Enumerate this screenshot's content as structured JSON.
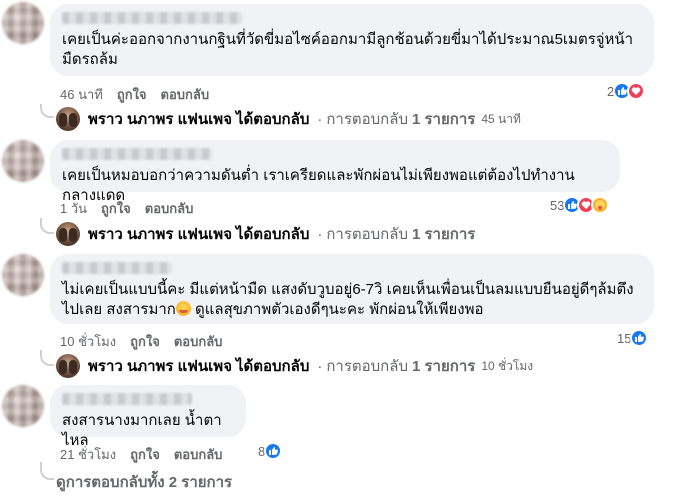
{
  "comments": [
    {
      "text": "เคยเป็นค่ะออกจากงานกฐินที่วัดขี่มอไซค์ออกมามีลูกช้อนด้วยขี่มาได้ประมาณ5เมตรจู่หน้ามืดรถล้ม",
      "time": "46 นาที",
      "like": "ถูกใจ",
      "reply": "ตอบกลับ",
      "reactions": "2",
      "reply_preview": {
        "name": "พราว นภาพร แฟนเพจ",
        "action": "ได้ตอบกลับ",
        "sep": "·",
        "label": "การตอบกลับ",
        "count": "1 รายการ",
        "time": "45 นาที"
      }
    },
    {
      "text": "เคยเป็นหมอบอกว่าความดันต่ำ เราเครียดและพักผ่อนไม่เพียงพอแต่ต้องไปทำงานกลางแดด",
      "time": "1 วัน",
      "like": "ถูกใจ",
      "reply": "ตอบกลับ",
      "reactions": "53",
      "reply_preview": {
        "name": "พราว นภาพร แฟนเพจ",
        "action": "ได้ตอบกลับ",
        "sep": "·",
        "label": "การตอบกลับ",
        "count": "1 รายการ",
        "time": ""
      }
    },
    {
      "text_a": "ไม่เคยเป็นแบบนี้คะ มีแต่หน้ามืด แสงดับวูบอยู่6-7วิ เคยเห็นเพื่อนเป็นลมแบบยืนอยู่ดีๆล้มตึงไปเลย สงสารมาก",
      "text_b": " ดูแลสุขภาพตัวเองดีๆนะคะ พักผ่อนให้เพียงพอ",
      "time": "10 ชั่วโมง",
      "like": "ถูกใจ",
      "reply": "ตอบกลับ",
      "reactions": "15",
      "reply_preview": {
        "name": "พราว นภาพร แฟนเพจ",
        "action": "ได้ตอบกลับ",
        "sep": "·",
        "label": "การตอบกลับ",
        "count": "1 รายการ",
        "time": "10 ชั่วโมง"
      }
    },
    {
      "text": "สงสารนางมากเลย น้ำตาไหล",
      "time": "21 ชั่วโมง",
      "like": "ถูกใจ",
      "reply": "ตอบกลับ",
      "reactions": "8"
    }
  ],
  "see_all_replies": "ดูการตอบกลับทั้ง 2 รายการ",
  "colors": {
    "bubble": "#f0f2f5",
    "like_blue": "#1877f2",
    "love_red": "#f33e58",
    "care_yellow": "#f7b125",
    "meta_gray": "#65676b"
  }
}
